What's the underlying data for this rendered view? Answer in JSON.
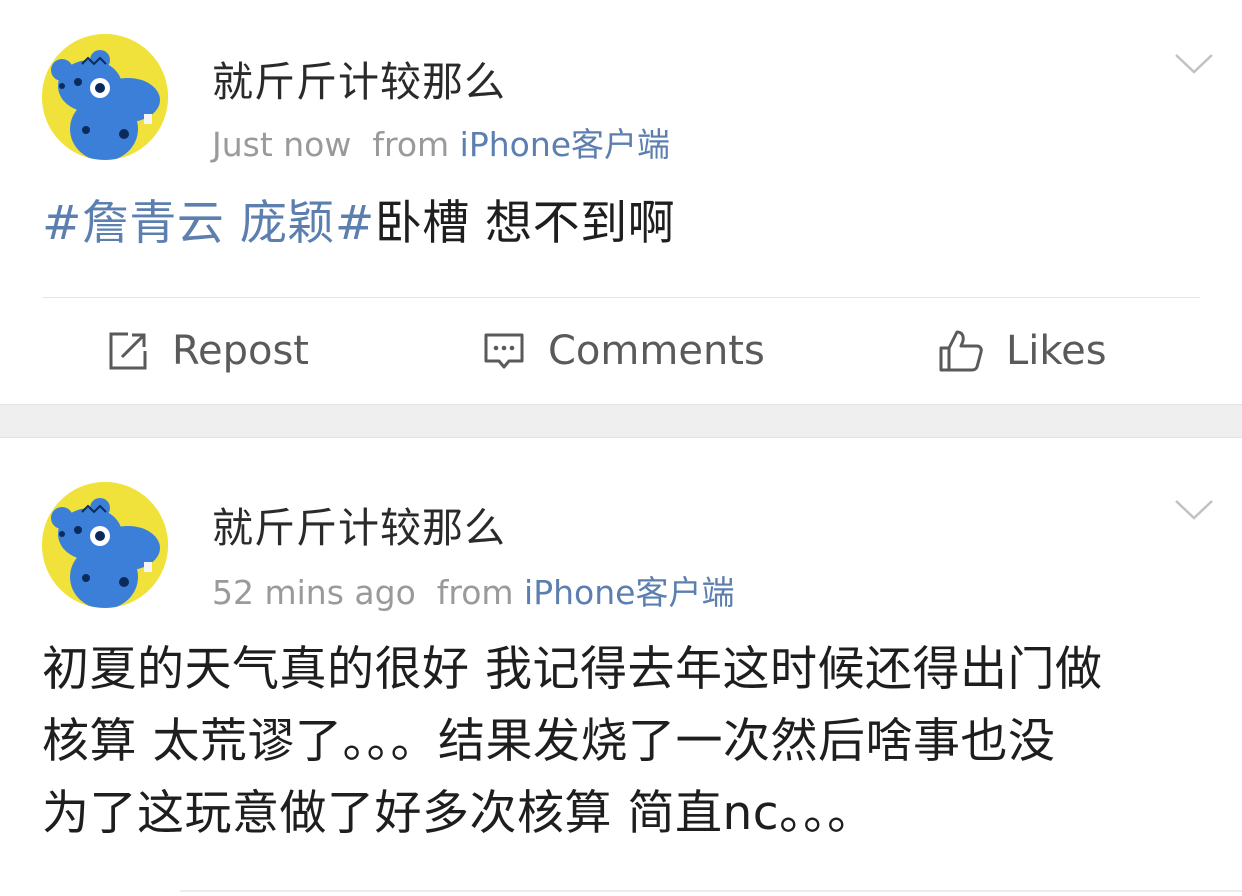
{
  "posts": [
    {
      "username": "就斤斤计较那么",
      "time": "Just now",
      "from_label": "from",
      "source": "iPhone客户端",
      "topic": "#詹青云 庞颖#",
      "text": "卧槽 想不到啊"
    },
    {
      "username": "就斤斤计较那么",
      "time": "52 mins ago",
      "from_label": "from",
      "source": "iPhone客户端",
      "text_lines": [
        "初夏的天气真的很好 我记得去年这时候还得出门做",
        "核算 太荒谬了。。。结果发烧了一次然后啥事也没",
        "为了这玩意做了好多次核算 简直nc。。。"
      ]
    }
  ],
  "actions": {
    "repost_label": "Repost",
    "comments_label": "Comments",
    "likes_label": "Likes"
  },
  "icons": {
    "repost": "share-square-icon",
    "comments": "comment-bubble-icon",
    "likes": "thumbs-up-icon",
    "more": "chevron-down-icon"
  },
  "colors": {
    "link": "#5c7fb0",
    "meta_gray": "#9a9a9a",
    "avatar_bg": "#f0e23a",
    "avatar_fg": "#3b7fd9"
  }
}
